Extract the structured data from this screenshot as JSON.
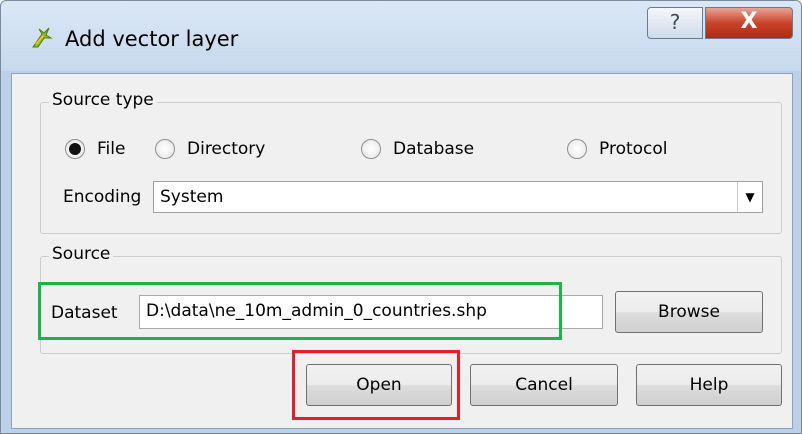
{
  "window": {
    "title": "Add vector layer",
    "help_glyph": "?",
    "close_glyph": "X"
  },
  "source_type": {
    "group_label": "Source type",
    "options": [
      {
        "label": "File",
        "checked": true
      },
      {
        "label": "Directory",
        "checked": false
      },
      {
        "label": "Database",
        "checked": false
      },
      {
        "label": "Protocol",
        "checked": false
      }
    ],
    "encoding_label": "Encoding",
    "encoding_value": "System"
  },
  "source": {
    "group_label": "Source",
    "dataset_label": "Dataset",
    "dataset_value": "D:\\data\\ne_10m_admin_0_countries.shp",
    "browse_label": "Browse"
  },
  "buttons": {
    "open": "Open",
    "cancel": "Cancel",
    "help": "Help"
  },
  "colors": {
    "dataset_highlight": "#1fb14a",
    "open_highlight": "#e0202a"
  }
}
